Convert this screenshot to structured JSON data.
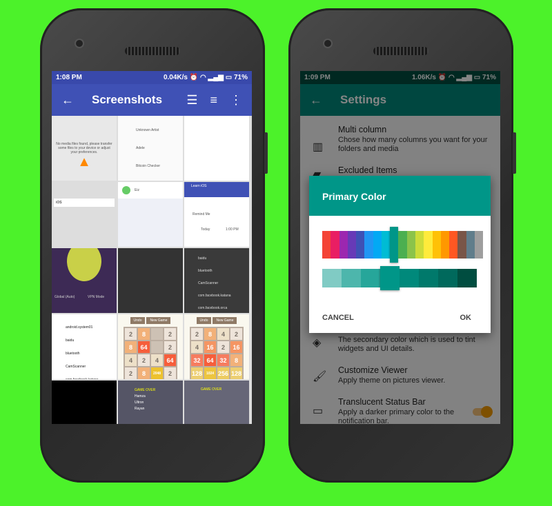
{
  "left_phone": {
    "status": {
      "time": "1:08 PM",
      "speed": "0.04K/s",
      "battery": "71%"
    },
    "toolbar": {
      "title": "Screenshots",
      "color": "#3f51b5"
    },
    "thumbs": {
      "vlc_empty": "No media files found, please transfer some files to your device or adjust your preferences.",
      "note_title": "iOS",
      "artists": [
        "Unknown Artist",
        "Adele",
        "Bitcoin Checker"
      ],
      "contact": "Eiz",
      "reminder_title": "Learn iOS",
      "remind_me": "Remind Me",
      "today": "Today",
      "time": "1:00 PM",
      "tor_mode": "Global (Auto)",
      "vpn": "VPN Mode",
      "folders_dark": [
        "baidu",
        "bluetooth",
        "CamScanner",
        "com.facebook.katana",
        "com.facebook.orca"
      ],
      "folders_light": [
        "android.system01",
        "baidu",
        "bluetooth",
        "CamScanner",
        "com.facebook.katana"
      ],
      "game_buttons": [
        "Undo",
        "New Game"
      ],
      "board1": [
        "2",
        "8",
        "",
        "2",
        "8",
        "64",
        "",
        "2",
        "4",
        "2",
        "4",
        "64",
        "2",
        "8",
        "2048",
        "2"
      ],
      "board2": [
        "2",
        "8",
        "4",
        "2",
        "4",
        "16",
        "2",
        "16",
        "32",
        "64",
        "32",
        "8",
        "128",
        "1024",
        "256",
        "128"
      ],
      "game_over": "GAME OVER",
      "players": [
        "Hamza",
        "Ultron",
        "Rayan"
      ]
    }
  },
  "right_phone": {
    "status": {
      "time": "1:09 PM",
      "speed": "1.06K/s",
      "battery": "71%"
    },
    "toolbar": {
      "title": "Settings",
      "color": "#00695c"
    },
    "settings": [
      {
        "title": "Multi column",
        "subtitle": "Chose how many columns you want for your folders and media",
        "icon": "columns-icon"
      },
      {
        "title": "Excluded Items",
        "subtitle": "",
        "icon": "folder-icon"
      },
      {
        "title": "",
        "subtitle": "The secondary color which is used to tint widgets and UI details.",
        "icon": "paint-bucket-icon"
      },
      {
        "title": "Customize Viewer",
        "subtitle": "Apply theme on pictures viewer.",
        "icon": "brush-icon"
      },
      {
        "title": "Translucent Status Bar",
        "subtitle": "Apply a darker primary color to the notification bar.",
        "icon": "window-icon",
        "toggle": true
      }
    ],
    "dialog": {
      "title": "Primary Color",
      "palette": [
        "#f44336",
        "#e91e63",
        "#9c27b0",
        "#673ab7",
        "#3f51b5",
        "#2196f3",
        "#03a9f4",
        "#00bcd4",
        "#009688",
        "#4caf50",
        "#8bc34a",
        "#cddc39",
        "#ffeb3b",
        "#ffc107",
        "#ff9800",
        "#ff5722",
        "#795548",
        "#607d8b",
        "#9e9e9e"
      ],
      "selected_index": 8,
      "shades": [
        "#80cbc4",
        "#4db6ac",
        "#26a69a",
        "#009688",
        "#00897b",
        "#00796b",
        "#00695c",
        "#004d40"
      ],
      "selected_shade": 3,
      "cancel": "CANCEL",
      "ok": "OK"
    }
  }
}
